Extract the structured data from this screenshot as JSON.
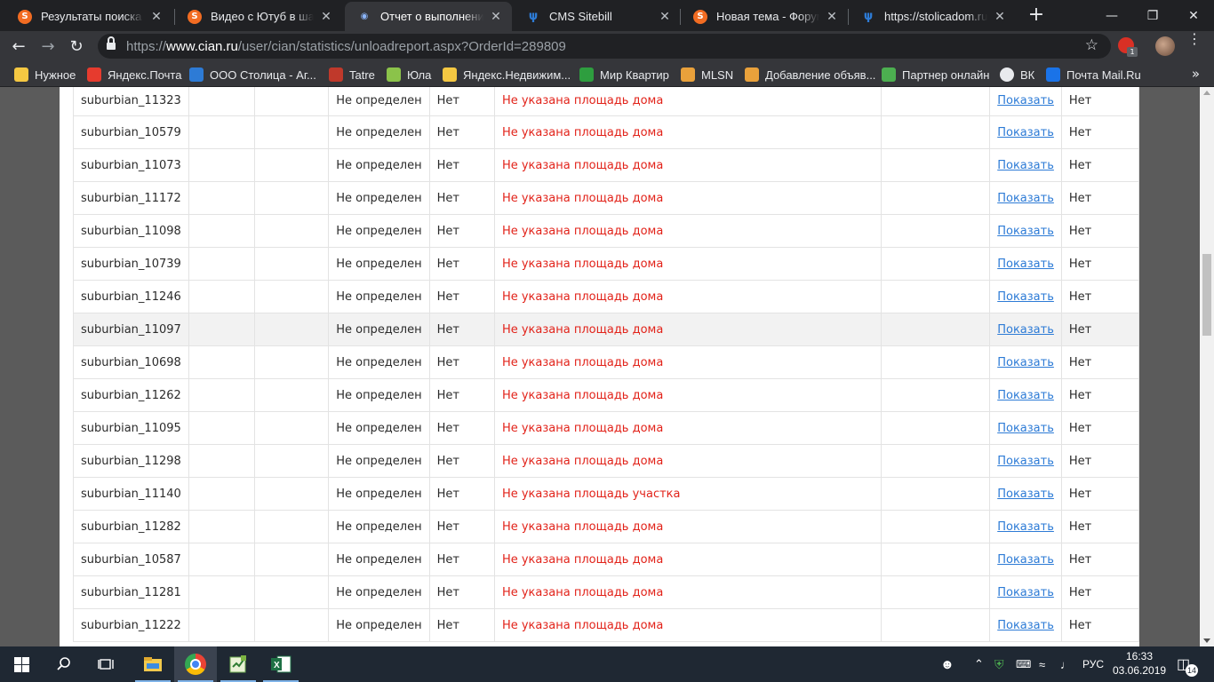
{
  "browser": {
    "tabs": [
      {
        "title": "Результаты поиска по",
        "icon": "s-logo-icon",
        "active": false
      },
      {
        "title": "Видео с Ютуб в шабло",
        "icon": "s-logo-icon",
        "active": false
      },
      {
        "title": "Отчет о выполнении з",
        "icon": "location-pin-icon",
        "active": true
      },
      {
        "title": "CMS Sitebill",
        "icon": "cian-logo-icon",
        "active": false
      },
      {
        "title": "Новая тема - Форум р",
        "icon": "s-logo-icon",
        "active": false
      },
      {
        "title": "https://stolicadom.ru/ci",
        "icon": "cian-logo-icon",
        "active": false
      }
    ],
    "url_scheme": "https://",
    "url_host": "www.cian.ru",
    "url_path": "/user/cian/statistics/unloadreport.aspx?OrderId=289809",
    "extension_badge": "1",
    "bookmarks": [
      {
        "label": "Нужное",
        "icon": "folder-icon",
        "color": "#f5c842"
      },
      {
        "label": "Яндекс.Почта",
        "icon": "yandex-mail-icon",
        "color": "#e63b2e"
      },
      {
        "label": "ООО Столица - Аг...",
        "icon": "cian-logo-icon",
        "color": "#2d7bd6"
      },
      {
        "label": "Tatre",
        "icon": "tatre-icon",
        "color": "#c0392b"
      },
      {
        "label": "Юла",
        "icon": "yula-icon",
        "color": "#8bc34a"
      },
      {
        "label": "Яндекс.Недвижим...",
        "icon": "yandex-realty-icon",
        "color": "#f5c842"
      },
      {
        "label": "Мир Квартир",
        "icon": "mk-icon",
        "color": "#2e9e3f"
      },
      {
        "label": "MLSN",
        "icon": "mlsn-icon",
        "color": "#e9a13b"
      },
      {
        "label": "Добавление объяв...",
        "icon": "grid-icon",
        "color": "#e9a13b"
      },
      {
        "label": "Партнер онлайн",
        "icon": "partner-icon",
        "color": "#4caf50"
      },
      {
        "label": "ВК",
        "icon": "vk-icon",
        "color": "#ffffff"
      },
      {
        "label": "Почта Mail.Ru",
        "icon": "mailru-icon",
        "color": "#1a73e8"
      }
    ]
  },
  "report": {
    "rows": [
      {
        "id": "suburbian_11323",
        "region": "Не определен",
        "flag": "Нет",
        "error": "Не указана площадь дома",
        "action": "Показать",
        "status": "Нет"
      },
      {
        "id": "suburbian_10579",
        "region": "Не определен",
        "flag": "Нет",
        "error": "Не указана площадь дома",
        "action": "Показать",
        "status": "Нет"
      },
      {
        "id": "suburbian_11073",
        "region": "Не определен",
        "flag": "Нет",
        "error": "Не указана площадь дома",
        "action": "Показать",
        "status": "Нет"
      },
      {
        "id": "suburbian_11172",
        "region": "Не определен",
        "flag": "Нет",
        "error": "Не указана площадь дома",
        "action": "Показать",
        "status": "Нет"
      },
      {
        "id": "suburbian_11098",
        "region": "Не определен",
        "flag": "Нет",
        "error": "Не указана площадь дома",
        "action": "Показать",
        "status": "Нет"
      },
      {
        "id": "suburbian_10739",
        "region": "Не определен",
        "flag": "Нет",
        "error": "Не указана площадь дома",
        "action": "Показать",
        "status": "Нет"
      },
      {
        "id": "suburbian_11246",
        "region": "Не определен",
        "flag": "Нет",
        "error": "Не указана площадь дома",
        "action": "Показать",
        "status": "Нет"
      },
      {
        "id": "suburbian_11097",
        "region": "Не определен",
        "flag": "Нет",
        "error": "Не указана площадь дома",
        "action": "Показать",
        "status": "Нет"
      },
      {
        "id": "suburbian_10698",
        "region": "Не определен",
        "flag": "Нет",
        "error": "Не указана площадь дома",
        "action": "Показать",
        "status": "Нет"
      },
      {
        "id": "suburbian_11262",
        "region": "Не определен",
        "flag": "Нет",
        "error": "Не указана площадь дома",
        "action": "Показать",
        "status": "Нет"
      },
      {
        "id": "suburbian_11095",
        "region": "Не определен",
        "flag": "Нет",
        "error": "Не указана площадь дома",
        "action": "Показать",
        "status": "Нет"
      },
      {
        "id": "suburbian_11298",
        "region": "Не определен",
        "flag": "Нет",
        "error": "Не указана площадь дома",
        "action": "Показать",
        "status": "Нет"
      },
      {
        "id": "suburbian_11140",
        "region": "Не определен",
        "flag": "Нет",
        "error": "Не указана площадь участка",
        "action": "Показать",
        "status": "Нет"
      },
      {
        "id": "suburbian_11282",
        "region": "Не определен",
        "flag": "Нет",
        "error": "Не указана площадь дома",
        "action": "Показать",
        "status": "Нет"
      },
      {
        "id": "suburbian_10587",
        "region": "Не определен",
        "flag": "Нет",
        "error": "Не указана площадь дома",
        "action": "Показать",
        "status": "Нет"
      },
      {
        "id": "suburbian_11281",
        "region": "Не определен",
        "flag": "Нет",
        "error": "Не указана площадь дома",
        "action": "Показать",
        "status": "Нет"
      },
      {
        "id": "suburbian_11222",
        "region": "Не определен",
        "flag": "Нет",
        "error": "Не указана площадь дома",
        "action": "Показать",
        "status": "Нет"
      }
    ],
    "hovered_row": 7,
    "colors": {
      "error": "#e2231a",
      "link": "#2d7bd6"
    }
  },
  "taskbar": {
    "language": "РУС",
    "time": "16:33",
    "date": "03.06.2019",
    "notifications": "14",
    "apps": [
      "windows-start-icon",
      "search-icon",
      "task-view-icon",
      "file-explorer-icon",
      "chrome-icon",
      "notepad-icon",
      "excel-icon"
    ]
  }
}
